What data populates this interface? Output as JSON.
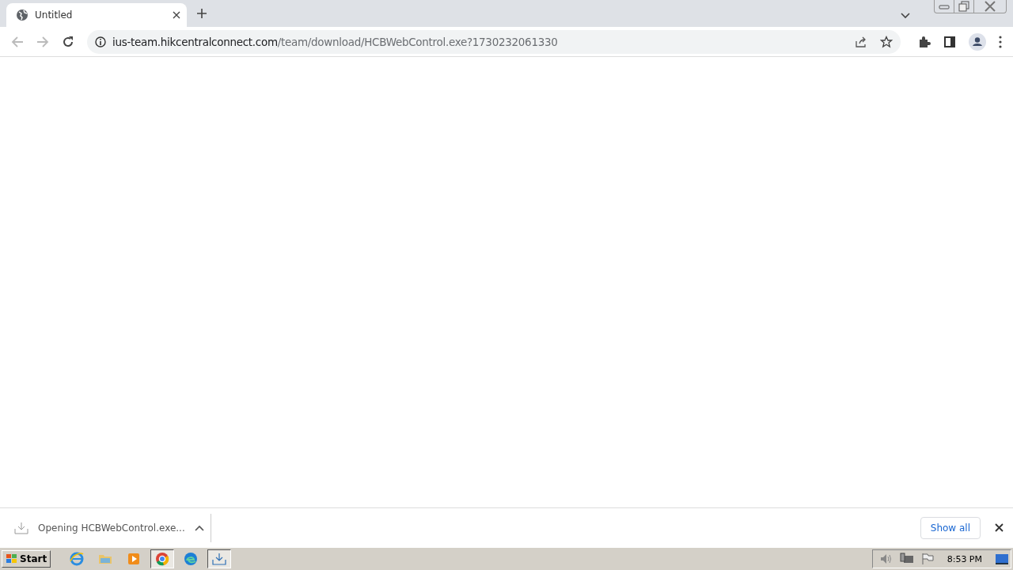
{
  "tabs": [
    {
      "title": "Untitled",
      "selected": true
    }
  ],
  "address_bar": {
    "host": "ius-team.hikcentralconnect.com",
    "path": "/team/download/HCBWebControl.exe?1730232061330"
  },
  "download_bar": {
    "item": "Opening HCBWebControl.exe...",
    "show_all": "Show all"
  },
  "taskbar": {
    "start": "Start",
    "apps": [
      {
        "kind": "ie",
        "selected": false
      },
      {
        "kind": "folder",
        "selected": false
      },
      {
        "kind": "media",
        "selected": false
      },
      {
        "kind": "chrome",
        "selected": true
      },
      {
        "kind": "edge",
        "selected": false
      },
      {
        "kind": "download",
        "selected": true
      }
    ],
    "clock": "8:53 PM"
  }
}
